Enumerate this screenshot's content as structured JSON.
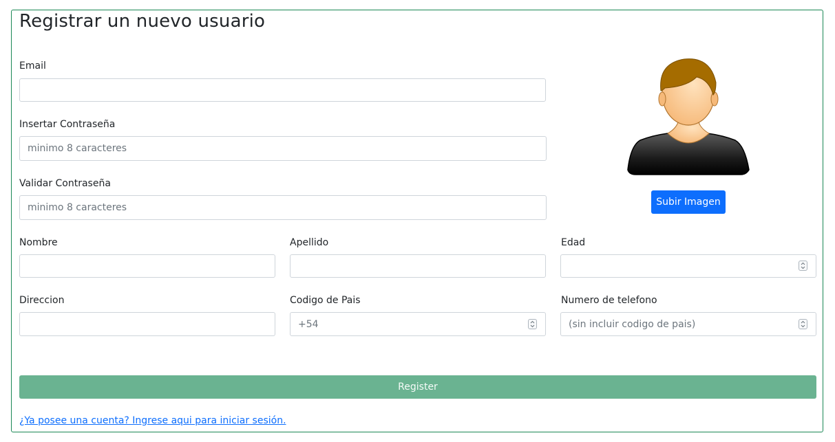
{
  "form": {
    "title": "Registrar un nuevo usuario",
    "email": {
      "label": "Email",
      "value": ""
    },
    "password": {
      "label": "Insertar Contraseña",
      "placeholder": "minimo 8 caracteres"
    },
    "password_confirm": {
      "label": "Validar Contraseña",
      "placeholder": "minimo 8 caracteres"
    },
    "first_name": {
      "label": "Nombre",
      "value": ""
    },
    "last_name": {
      "label": "Apellido",
      "value": ""
    },
    "age": {
      "label": "Edad",
      "value": ""
    },
    "address": {
      "label": "Direccion",
      "value": ""
    },
    "country_code": {
      "label": "Codigo de Pais",
      "placeholder": "+54"
    },
    "phone": {
      "label": "Numero de telefono",
      "placeholder": "(sin incluir codigo de pais)"
    },
    "upload_label": "Subir Imagen",
    "register_label": "Register",
    "login_link": "¿Ya posee una cuenta? Ingrese aqui para iniciar sesión."
  },
  "colors": {
    "card_border": "#198754",
    "upload_button": "#0d6efd",
    "register_button": "#6ab391",
    "link": "#0d6efd"
  },
  "icons": {
    "avatar": "user-avatar-icon",
    "number_spinner": "spinner-icon"
  }
}
